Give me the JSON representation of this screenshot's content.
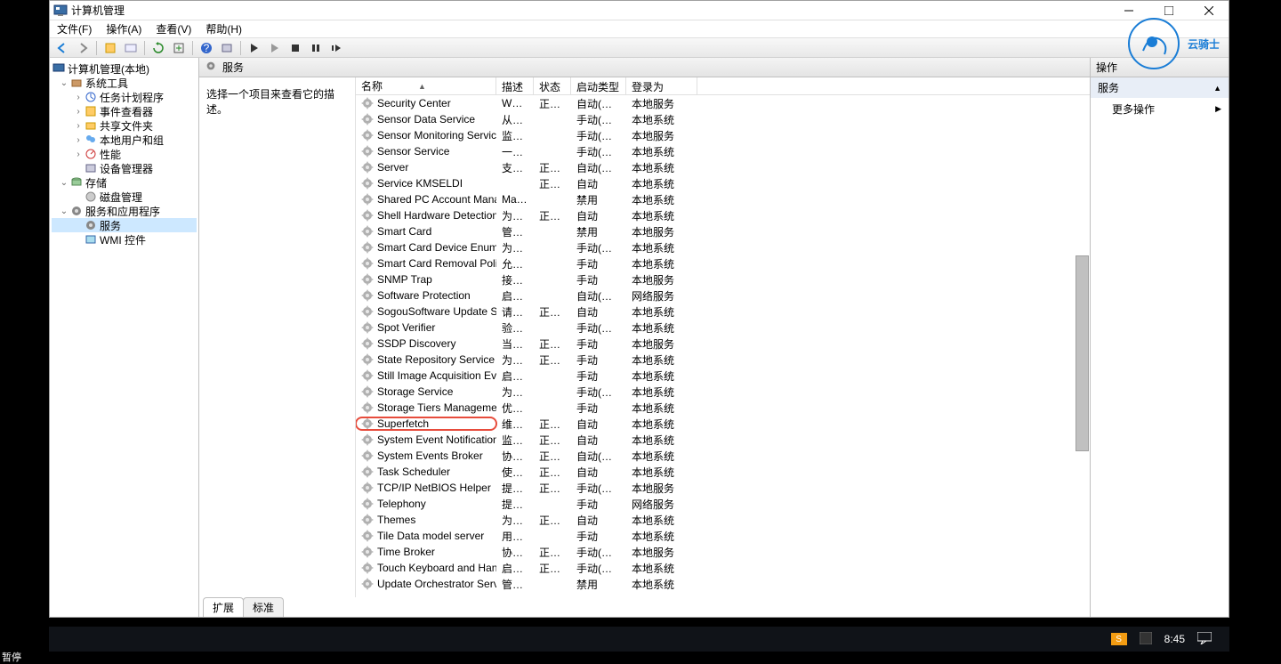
{
  "window": {
    "title": "计算机管理"
  },
  "menubar": [
    "文件(F)",
    "操作(A)",
    "查看(V)",
    "帮助(H)"
  ],
  "tree": {
    "root": "计算机管理(本地)",
    "groups": [
      {
        "label": "系统工具",
        "open": true,
        "children": [
          "任务计划程序",
          "事件查看器",
          "共享文件夹",
          "本地用户和组",
          "性能",
          "设备管理器"
        ]
      },
      {
        "label": "存储",
        "open": true,
        "children": [
          "磁盘管理"
        ]
      },
      {
        "label": "服务和应用程序",
        "open": true,
        "children": [
          "服务",
          "WMI 控件"
        ],
        "selected": "服务"
      }
    ]
  },
  "center": {
    "header": "服务",
    "desc_pane": "选择一个项目来查看它的描述。",
    "columns": {
      "name": "名称",
      "desc": "描述",
      "status": "状态",
      "startup": "启动类型",
      "logon": "登录为"
    },
    "tabs": [
      "扩展",
      "标准"
    ]
  },
  "actions": {
    "header": "操作",
    "section": "服务",
    "more": "更多操作"
  },
  "services": [
    {
      "name": "Security Center",
      "desc": "WSC...",
      "status": "正在...",
      "startup": "自动(延迟...",
      "logon": "本地服务"
    },
    {
      "name": "Sensor Data Service",
      "desc": "从各...",
      "status": "",
      "startup": "手动(触发...",
      "logon": "本地系统"
    },
    {
      "name": "Sensor Monitoring Service",
      "desc": "监视...",
      "status": "",
      "startup": "手动(触发...",
      "logon": "本地服务"
    },
    {
      "name": "Sensor Service",
      "desc": "一项...",
      "status": "",
      "startup": "手动(触发...",
      "logon": "本地系统"
    },
    {
      "name": "Server",
      "desc": "支持...",
      "status": "正在...",
      "startup": "自动(触发...",
      "logon": "本地系统"
    },
    {
      "name": "Service KMSELDI",
      "desc": "",
      "status": "正在...",
      "startup": "自动",
      "logon": "本地系统"
    },
    {
      "name": "Shared PC Account Manager",
      "desc": "Man...",
      "status": "",
      "startup": "禁用",
      "logon": "本地系统"
    },
    {
      "name": "Shell Hardware Detection",
      "desc": "为自...",
      "status": "正在...",
      "startup": "自动",
      "logon": "本地系统"
    },
    {
      "name": "Smart Card",
      "desc": "管理...",
      "status": "",
      "startup": "禁用",
      "logon": "本地服务"
    },
    {
      "name": "Smart Card Device Enumer...",
      "desc": "为给...",
      "status": "",
      "startup": "手动(触发...",
      "logon": "本地系统"
    },
    {
      "name": "Smart Card Removal Policy",
      "desc": "允许...",
      "status": "",
      "startup": "手动",
      "logon": "本地系统"
    },
    {
      "name": "SNMP Trap",
      "desc": "接收...",
      "status": "",
      "startup": "手动",
      "logon": "本地服务"
    },
    {
      "name": "Software Protection",
      "desc": "启用 ...",
      "status": "",
      "startup": "自动(延迟...",
      "logon": "网络服务"
    },
    {
      "name": "SogouSoftware Update Ser...",
      "desc": "请确...",
      "status": "正在...",
      "startup": "自动",
      "logon": "本地系统"
    },
    {
      "name": "Spot Verifier",
      "desc": "验证...",
      "status": "",
      "startup": "手动(触发...",
      "logon": "本地系统"
    },
    {
      "name": "SSDP Discovery",
      "desc": "当发...",
      "status": "正在...",
      "startup": "手动",
      "logon": "本地服务"
    },
    {
      "name": "State Repository Service",
      "desc": "为应...",
      "status": "正在...",
      "startup": "手动",
      "logon": "本地系统"
    },
    {
      "name": "Still Image Acquisition Events",
      "desc": "启动...",
      "status": "",
      "startup": "手动",
      "logon": "本地系统"
    },
    {
      "name": "Storage Service",
      "desc": "为存...",
      "status": "",
      "startup": "手动(触发...",
      "logon": "本地系统"
    },
    {
      "name": "Storage Tiers Management",
      "desc": "优化...",
      "status": "",
      "startup": "手动",
      "logon": "本地系统"
    },
    {
      "name": "Superfetch",
      "desc": "维护...",
      "status": "正在...",
      "startup": "自动",
      "logon": "本地系统",
      "hl": true
    },
    {
      "name": "System Event Notification S...",
      "desc": "监视...",
      "status": "正在...",
      "startup": "自动",
      "logon": "本地系统"
    },
    {
      "name": "System Events Broker",
      "desc": "协调...",
      "status": "正在...",
      "startup": "自动(触发...",
      "logon": "本地系统"
    },
    {
      "name": "Task Scheduler",
      "desc": "使用...",
      "status": "正在...",
      "startup": "自动",
      "logon": "本地系统"
    },
    {
      "name": "TCP/IP NetBIOS Helper",
      "desc": "提供 ...",
      "status": "正在...",
      "startup": "手动(触发...",
      "logon": "本地服务"
    },
    {
      "name": "Telephony",
      "desc": "提供...",
      "status": "",
      "startup": "手动",
      "logon": "网络服务"
    },
    {
      "name": "Themes",
      "desc": "为用...",
      "status": "正在...",
      "startup": "自动",
      "logon": "本地系统"
    },
    {
      "name": "Tile Data model server",
      "desc": "用于...",
      "status": "",
      "startup": "手动",
      "logon": "本地系统"
    },
    {
      "name": "Time Broker",
      "desc": "协调...",
      "status": "正在...",
      "startup": "手动(触发...",
      "logon": "本地服务"
    },
    {
      "name": "Touch Keyboard and Hand...",
      "desc": "启用...",
      "status": "正在...",
      "startup": "手动(触发...",
      "logon": "本地系统"
    },
    {
      "name": "Update Orchestrator Service",
      "desc": "管理 ...",
      "status": "",
      "startup": "禁用",
      "logon": "本地系统"
    }
  ],
  "watermark": "云骑士",
  "taskbar": {
    "clock": "8:45",
    "ime": "S"
  },
  "footer": "暂停"
}
